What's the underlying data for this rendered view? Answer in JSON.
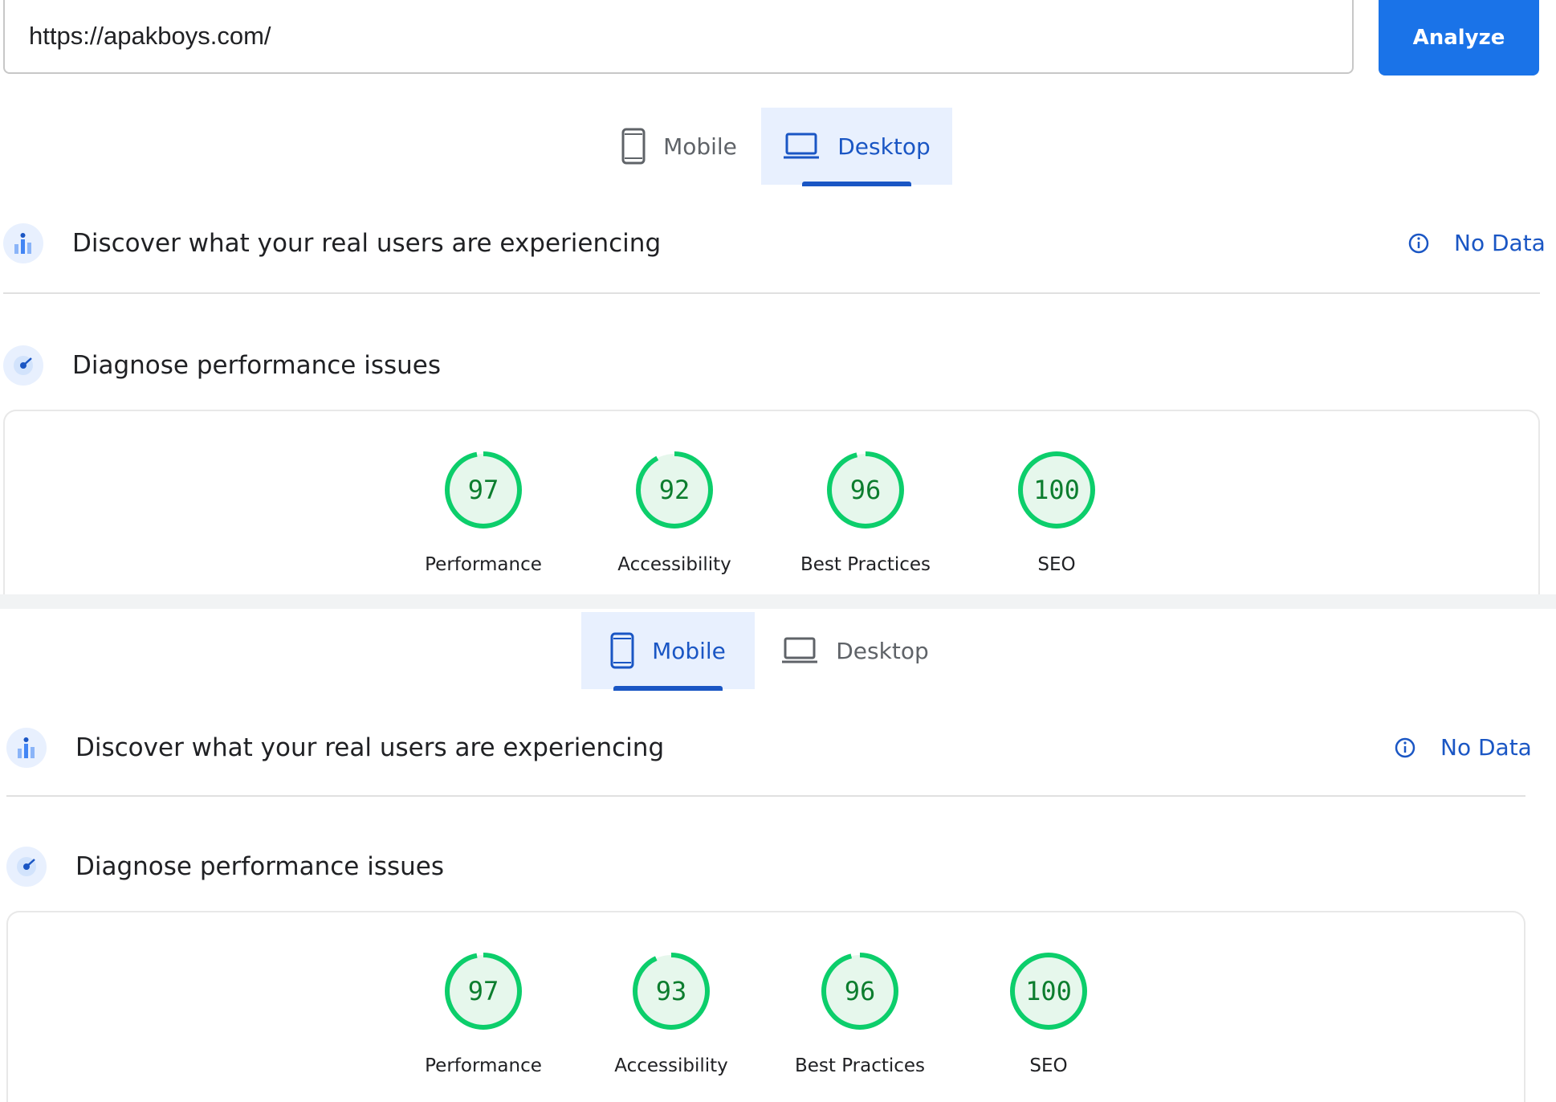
{
  "url_bar": {
    "value": "https://apakboys.com/",
    "button_label": "Analyze"
  },
  "panels": [
    {
      "tabs": [
        {
          "label": "Mobile",
          "icon": "phone-icon",
          "active": false
        },
        {
          "label": "Desktop",
          "icon": "laptop-icon",
          "active": true
        }
      ],
      "field_data": {
        "title": "Discover what your real users are experiencing",
        "status": "No Data"
      },
      "diagnose": {
        "title": "Diagnose performance issues"
      },
      "scores": [
        {
          "label": "Performance",
          "value": 97
        },
        {
          "label": "Accessibility",
          "value": 92
        },
        {
          "label": "Best Practices",
          "value": 96
        },
        {
          "label": "SEO",
          "value": 100
        }
      ]
    },
    {
      "tabs": [
        {
          "label": "Mobile",
          "icon": "phone-icon",
          "active": true
        },
        {
          "label": "Desktop",
          "icon": "laptop-icon",
          "active": false
        }
      ],
      "field_data": {
        "title": "Discover what your real users are experiencing",
        "status": "No Data"
      },
      "diagnose": {
        "title": "Diagnose performance issues"
      },
      "scores": [
        {
          "label": "Performance",
          "value": 97
        },
        {
          "label": "Accessibility",
          "value": 93
        },
        {
          "label": "Best Practices",
          "value": 96
        },
        {
          "label": "SEO",
          "value": 100
        }
      ]
    }
  ],
  "colors": {
    "pass": "#0cce6b",
    "pass_text": "#0c7d2e",
    "pass_bg": "#e6f7ec",
    "accent": "#1a73e8"
  }
}
